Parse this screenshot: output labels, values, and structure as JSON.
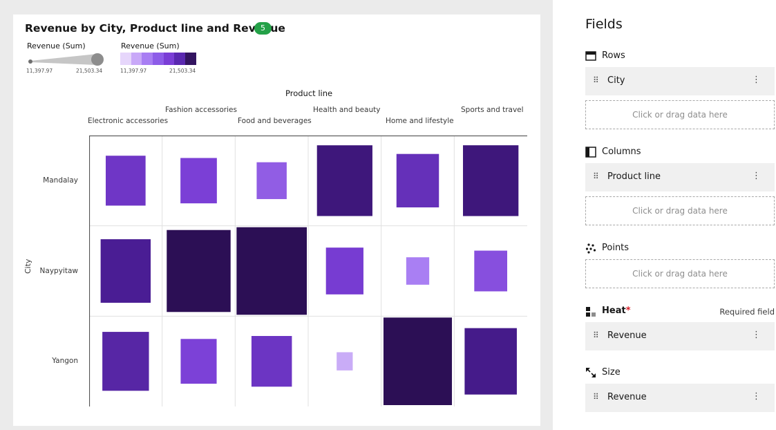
{
  "visualization": {
    "title": "Revenue by City, Product line and Revenue",
    "badge_count": "5",
    "size_legend": {
      "title": "Revenue (Sum)",
      "min": "11,397.97",
      "max": "21,503.34"
    },
    "color_legend": {
      "title": "Revenue (Sum)",
      "min": "11,397.97",
      "max": "21,503.34",
      "colors": [
        "#e6d6fb",
        "#c8a8f8",
        "#a87ef3",
        "#8d5ce8",
        "#7a3ed6",
        "#5a28b0",
        "#331460"
      ]
    },
    "column_axis_title": "Product line",
    "row_axis_title": "City"
  },
  "chart_data": {
    "type": "heatmap",
    "x_label": "Product line",
    "y_label": "City",
    "columns": [
      "Electronic accessories",
      "Fashion accessories",
      "Food and beverages",
      "Health and beauty",
      "Home and lifestyle",
      "Sports and travel"
    ],
    "rows": [
      "Mandalay",
      "Naypyitaw",
      "Yangon"
    ],
    "value_range": [
      11397.97,
      21503.34
    ],
    "value_label": "Revenue (Sum)",
    "values": [
      [
        17051.44,
        16413.32,
        15214.89,
        19980.66,
        17549.16,
        19988.2
      ],
      [
        18968.97,
        21560.07,
        23766.86,
        16615.33,
        13895.55,
        15761.93
      ],
      [
        18317.11,
        16332.51,
        17163.1,
        12597.75,
        22417.2,
        19372.7
      ]
    ]
  },
  "panel": {
    "title": "Fields",
    "rows": {
      "label": "Rows",
      "field": "City",
      "drop_hint": "Click or drag data here"
    },
    "columns": {
      "label": "Columns",
      "field": "Product line",
      "drop_hint": "Click or drag data here"
    },
    "points": {
      "label": "Points",
      "drop_hint": "Click or drag data here"
    },
    "heat": {
      "label": "Heat",
      "required_mark": "*",
      "required_text": "Required field",
      "field": "Revenue"
    },
    "size": {
      "label": "Size",
      "field": "Revenue"
    }
  }
}
